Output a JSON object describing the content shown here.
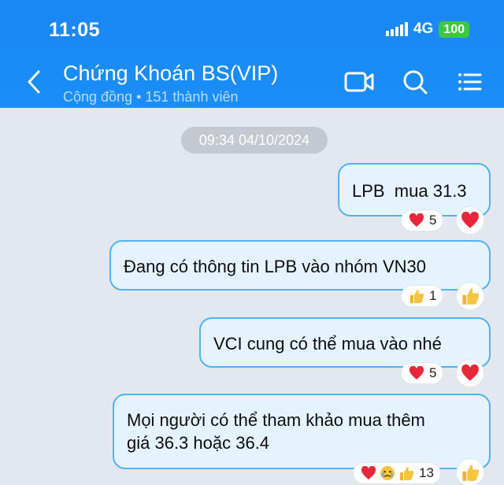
{
  "status": {
    "time": "11:05",
    "network": "4G",
    "battery": "100"
  },
  "header": {
    "title": "Chứng Khoán BS(VIP)",
    "subtitle": "Cộng đồng • 151 thành viên"
  },
  "chat": {
    "date_separator": "09:34 04/10/2024",
    "messages": [
      {
        "text": "LPB  mua 31.3",
        "reaction_icons": [
          "heart"
        ],
        "reaction_count": "5",
        "react_button": "heart"
      },
      {
        "text": "Đang có thông tin LPB vào nhóm VN30",
        "reaction_icons": [
          "thumbs-up"
        ],
        "reaction_count": "1",
        "react_button": "thumbs-up"
      },
      {
        "text": "VCI cung có thể mua vào nhé",
        "reaction_icons": [
          "heart"
        ],
        "reaction_count": "5",
        "react_button": "heart"
      },
      {
        "text": "Mọi người có thể tham khảo mua thêm\ngiá 36.3 hoặc 36.4",
        "reaction_icons": [
          "heart",
          "crying-face",
          "thumbs-up"
        ],
        "reaction_count": "13",
        "react_button": "thumbs-up"
      }
    ]
  },
  "colors": {
    "header_bg": "#1b86f5",
    "bubble_bg": "#e4f3ff",
    "bubble_border": "#4eb2f3",
    "chat_bg": "#e3e8ef"
  }
}
